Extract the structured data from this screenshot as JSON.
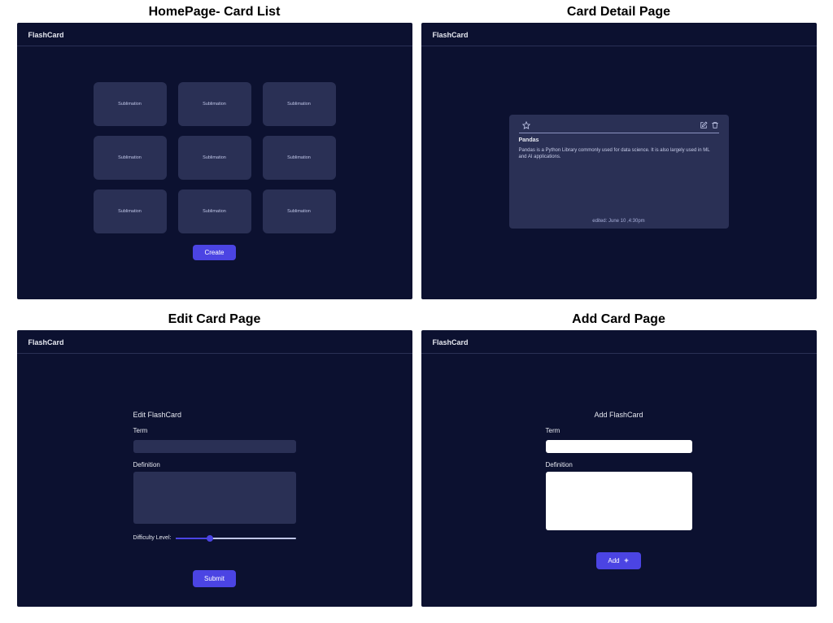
{
  "app_name": "FlashCard",
  "colors": {
    "bg": "#0c1130",
    "panel": "#2a3055",
    "accent": "#4b44e3"
  },
  "homepage": {
    "title": "HomePage- Card List",
    "cards": [
      "Sublimation",
      "Sublimation",
      "Sublimation",
      "Sublimation",
      "Sublimation",
      "Sublimation",
      "Sublimation",
      "Sublimation",
      "Sublimation"
    ],
    "create_label": "Create"
  },
  "detail": {
    "title": "Card Detail Page",
    "icons": {
      "star": "star-icon",
      "edit": "edit-icon",
      "delete": "trash-icon"
    },
    "term": "Pandas",
    "definition": "Pandas is a Python Library commonly used for data science. It is also largely used in ML and AI applications.",
    "edited_label": "edited: June 10 ,4:30pm"
  },
  "edit": {
    "title": "Edit Card Page",
    "heading": "Edit FlashCard",
    "term_label": "Term",
    "definition_label": "Definition",
    "difficulty_label": "Difficulty Level:",
    "difficulty_value": 28,
    "submit_label": "Submit"
  },
  "add": {
    "title": "Add Card Page",
    "heading": "Add FlashCard",
    "term_label": "Term",
    "definition_label": "Definition",
    "add_label": "Add"
  }
}
